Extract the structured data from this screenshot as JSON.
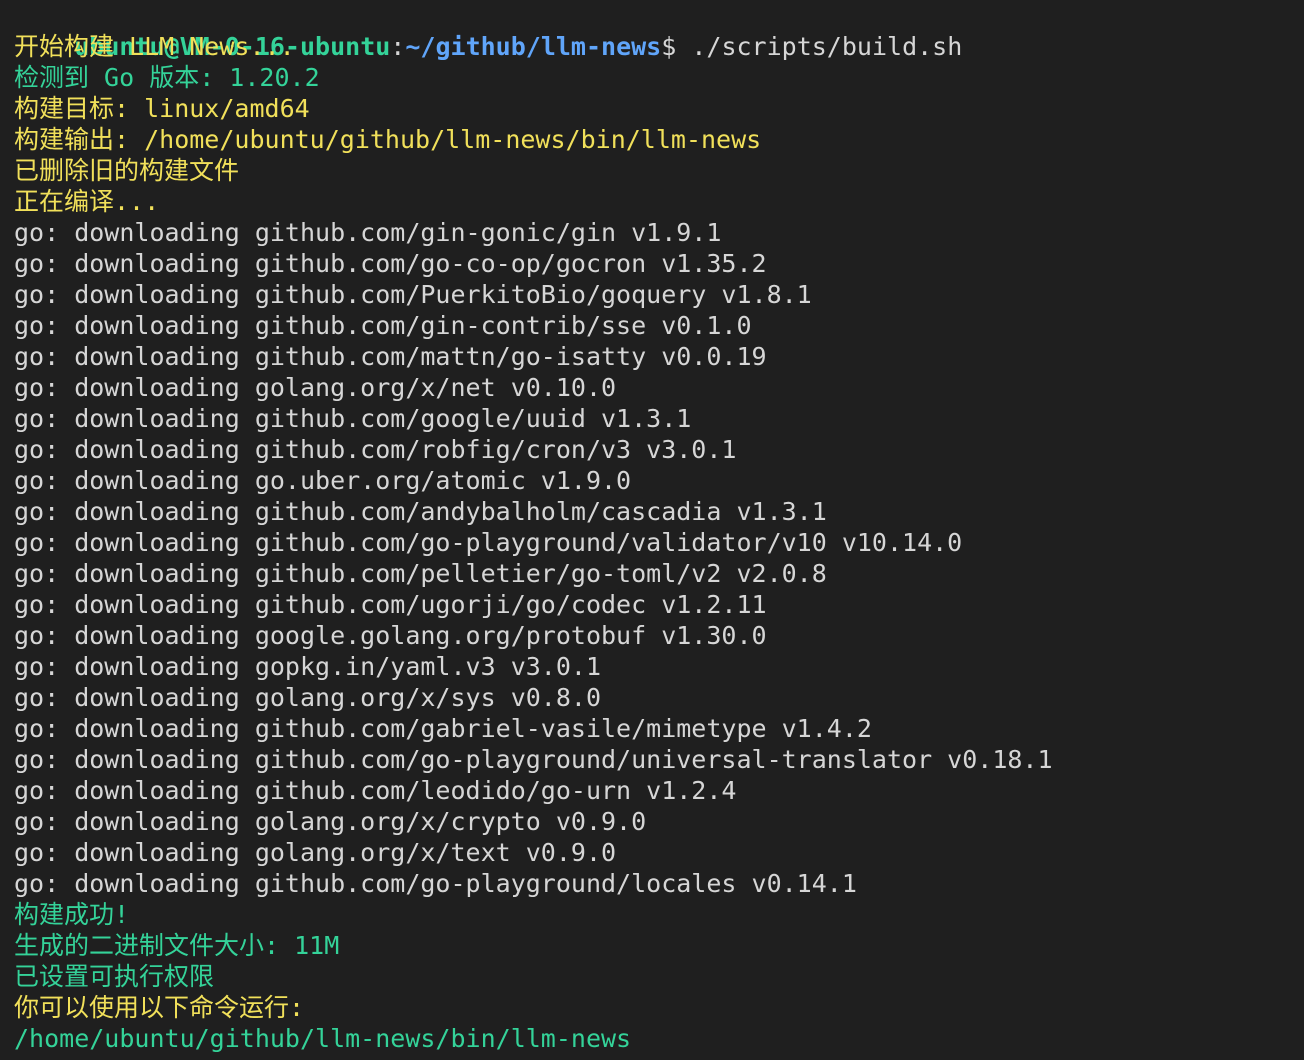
{
  "prompt": {
    "user_host": "ubuntu@VM-0-16-ubuntu",
    "separator": ":",
    "path": "~/github/llm-news",
    "symbol": "$",
    "command": " ./scripts/build.sh"
  },
  "colors": {
    "background": "#1f1f1f",
    "yellow": "#f1e05a",
    "green": "#34d399",
    "blue": "#60a5fa",
    "white": "#d6d6d6"
  },
  "build_header": [
    {
      "text": "开始构建 LLM News...",
      "color": "yellow"
    },
    {
      "text": "检测到 Go 版本: 1.20.2",
      "color": "green"
    },
    {
      "text": "构建目标: linux/amd64",
      "color": "yellow"
    },
    {
      "text": "构建输出: /home/ubuntu/github/llm-news/bin/llm-news",
      "color": "yellow"
    },
    {
      "text": "已删除旧的构建文件",
      "color": "yellow"
    },
    {
      "text": "正在编译...",
      "color": "yellow"
    }
  ],
  "downloads": [
    "go: downloading github.com/gin-gonic/gin v1.9.1",
    "go: downloading github.com/go-co-op/gocron v1.35.2",
    "go: downloading github.com/PuerkitoBio/goquery v1.8.1",
    "go: downloading github.com/gin-contrib/sse v0.1.0",
    "go: downloading github.com/mattn/go-isatty v0.0.19",
    "go: downloading golang.org/x/net v0.10.0",
    "go: downloading github.com/google/uuid v1.3.1",
    "go: downloading github.com/robfig/cron/v3 v3.0.1",
    "go: downloading go.uber.org/atomic v1.9.0",
    "go: downloading github.com/andybalholm/cascadia v1.3.1",
    "go: downloading github.com/go-playground/validator/v10 v10.14.0",
    "go: downloading github.com/pelletier/go-toml/v2 v2.0.8",
    "go: downloading github.com/ugorji/go/codec v1.2.11",
    "go: downloading google.golang.org/protobuf v1.30.0",
    "go: downloading gopkg.in/yaml.v3 v3.0.1",
    "go: downloading golang.org/x/sys v0.8.0",
    "go: downloading github.com/gabriel-vasile/mimetype v1.4.2",
    "go: downloading github.com/go-playground/universal-translator v0.18.1",
    "go: downloading github.com/leodido/go-urn v1.2.4",
    "go: downloading golang.org/x/crypto v0.9.0",
    "go: downloading golang.org/x/text v0.9.0",
    "go: downloading github.com/go-playground/locales v0.14.1"
  ],
  "build_footer": [
    {
      "text": "构建成功!",
      "color": "green"
    },
    {
      "text": "生成的二进制文件大小: 11M",
      "color": "green"
    },
    {
      "text": "已设置可执行权限",
      "color": "green"
    },
    {
      "text": "你可以使用以下命令运行:",
      "color": "yellow"
    },
    {
      "text": "/home/ubuntu/github/llm-news/bin/llm-news",
      "color": "green"
    }
  ]
}
